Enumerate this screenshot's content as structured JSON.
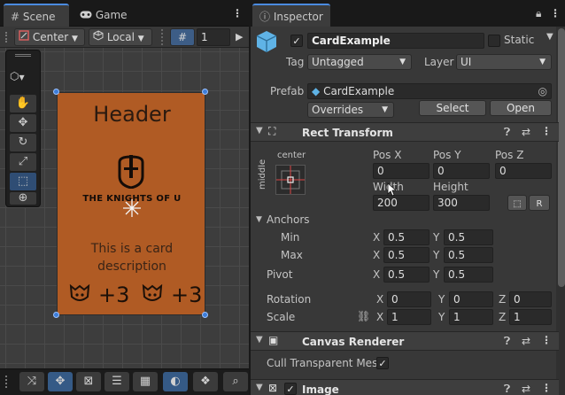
{
  "scene": {
    "tabs": [
      {
        "label": "Scene",
        "icon": "grid-icon"
      },
      {
        "label": "Game",
        "icon": "gamepad-icon"
      }
    ],
    "toolbar": {
      "pivot_mode": "Center",
      "pivot_rotation": "Local",
      "grid_value": "1"
    },
    "card": {
      "header": "Header",
      "logo_text": "THE KNIGHTS OF U",
      "description": "This is a card description",
      "stat_left": "+3",
      "stat_right": "+3"
    }
  },
  "inspector": {
    "tab": "Inspector",
    "object": {
      "name": "CardExample",
      "active": true,
      "static_label": "Static"
    },
    "tag": {
      "label": "Tag",
      "value": "Untagged"
    },
    "layer": {
      "label": "Layer",
      "value": "UI"
    },
    "prefab": {
      "label": "Prefab",
      "asset": "CardExample",
      "overrides": "Overrides",
      "select": "Select",
      "open": "Open"
    },
    "rect_transform": {
      "title": "Rect Transform",
      "anchor_h": "center",
      "anchor_v": "middle",
      "pos_x": {
        "label": "Pos X",
        "value": "0"
      },
      "pos_y": {
        "label": "Pos Y",
        "value": "0"
      },
      "pos_z": {
        "label": "Pos Z",
        "value": "0"
      },
      "width": {
        "label": "Width",
        "value": "200"
      },
      "height": {
        "label": "Height",
        "value": "300"
      },
      "blueprint_label": "R",
      "anchors_label": "Anchors",
      "min": {
        "label": "Min",
        "x": "0.5",
        "y": "0.5"
      },
      "max": {
        "label": "Max",
        "x": "0.5",
        "y": "0.5"
      },
      "pivot": {
        "label": "Pivot",
        "x": "0.5",
        "y": "0.5"
      },
      "rotation": {
        "label": "Rotation",
        "x": "0",
        "y": "0",
        "z": "0"
      },
      "scale": {
        "label": "Scale",
        "x": "1",
        "y": "1",
        "z": "1"
      },
      "axis_x": "X",
      "axis_y": "Y",
      "axis_z": "Z"
    },
    "canvas_renderer": {
      "title": "Canvas Renderer",
      "cull_label": "Cull Transparent Mesh",
      "cull_checked": true
    },
    "image": {
      "title": "Image",
      "enabled": true
    }
  },
  "colors": {
    "card": "#b05b24",
    "accent": "#4b8be0",
    "background": "#383838"
  }
}
